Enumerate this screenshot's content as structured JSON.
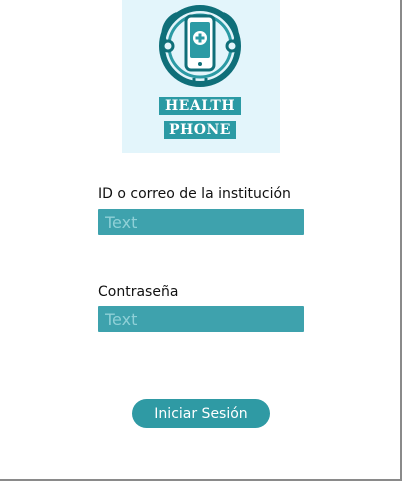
{
  "logo": {
    "line1": "HEALTH",
    "line2": "PHONE",
    "icon": "phone-stethoscope-icon",
    "colors": {
      "primary": "#2b9aa4",
      "dark": "#0f6f79",
      "background": "#e3f5fb"
    }
  },
  "form": {
    "id_label": "ID o correo de la institución",
    "id_placeholder": "Text",
    "password_label": "Contraseña",
    "password_placeholder": "Text",
    "submit_label": "Iniciar Sesión"
  },
  "colors": {
    "input_bg": "#3ea2ad",
    "button_bg": "#2f9aa4"
  }
}
